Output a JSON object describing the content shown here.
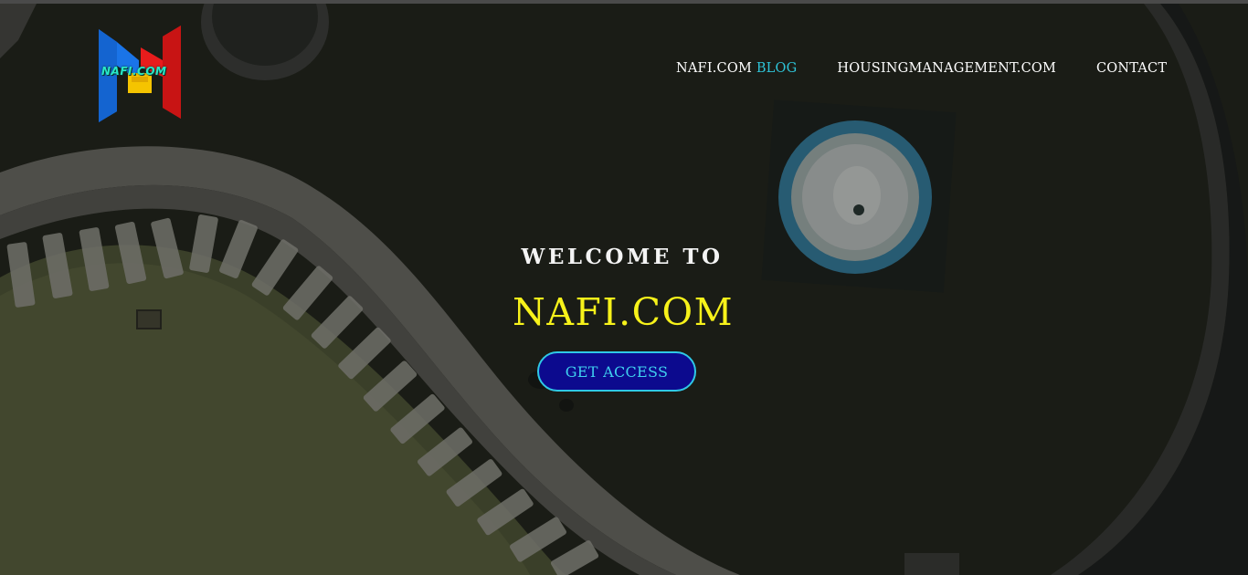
{
  "nav": {
    "items": [
      {
        "main": "NAFI.COM",
        "accent": "BLOG"
      },
      {
        "main": "HOUSINGMANAGEMENT.COM",
        "accent": ""
      },
      {
        "main": "CONTACT",
        "accent": ""
      }
    ]
  },
  "logo": {
    "text": "NAFI.COM",
    "colors": {
      "left": "#1a74e8",
      "right": "#e81c1c",
      "center": "#f5c400"
    }
  },
  "hero": {
    "welcome": "WELCOME TO",
    "brand": "NAFI.COM",
    "cta_label": "GET ACCESS"
  },
  "colors": {
    "nav_accent": "#2ec4d8",
    "brand_text": "#f7f21a",
    "cta_bg": "#0c0a8e",
    "cta_border": "#2fc8e6"
  }
}
